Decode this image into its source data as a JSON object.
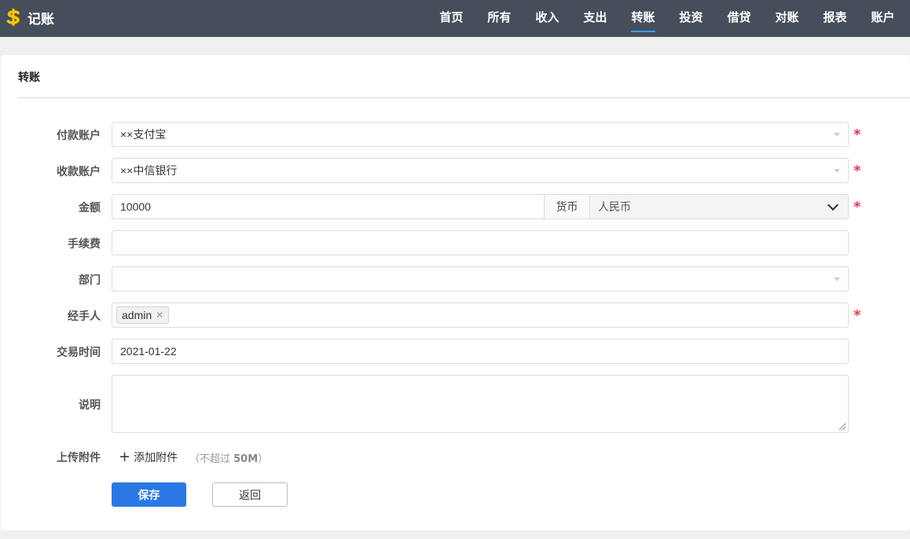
{
  "app": {
    "title": "记账",
    "logo_icon": "dollar-sign-icon",
    "logo_color": "#f5c400"
  },
  "nav": {
    "items": [
      {
        "label": "首页"
      },
      {
        "label": "所有"
      },
      {
        "label": "收入"
      },
      {
        "label": "支出"
      },
      {
        "label": "转账",
        "active": true
      },
      {
        "label": "投资"
      },
      {
        "label": "借贷"
      },
      {
        "label": "对账"
      },
      {
        "label": "报表"
      },
      {
        "label": "账户"
      }
    ],
    "active_color": "#3a9df2"
  },
  "panel": {
    "title": "转账"
  },
  "form": {
    "payer": {
      "label": "付款账户",
      "value": "××支付宝",
      "required": true
    },
    "payee": {
      "label": "收款账户",
      "value": "××中信银行",
      "required": true
    },
    "amount": {
      "label": "金额",
      "value": "10000",
      "currency_label": "货币",
      "currency_value": "人民币",
      "required": true
    },
    "fee": {
      "label": "手续费",
      "value": ""
    },
    "department": {
      "label": "部门",
      "value": ""
    },
    "handler": {
      "label": "经手人",
      "tag": "admin",
      "required": true
    },
    "date": {
      "label": "交易时间",
      "value": "2021-01-22"
    },
    "note": {
      "label": "说明",
      "value": ""
    },
    "attachment": {
      "label": "上传附件",
      "button": "添加附件",
      "hint_prefix": "（不超过 ",
      "hint_size": "50M",
      "hint_suffix": "）"
    },
    "required_mark": "*"
  },
  "buttons": {
    "save": "保存",
    "back": "返回"
  },
  "colors": {
    "topbar": "#464e5b",
    "primary": "#2b78e4",
    "required": "#e8364d"
  }
}
